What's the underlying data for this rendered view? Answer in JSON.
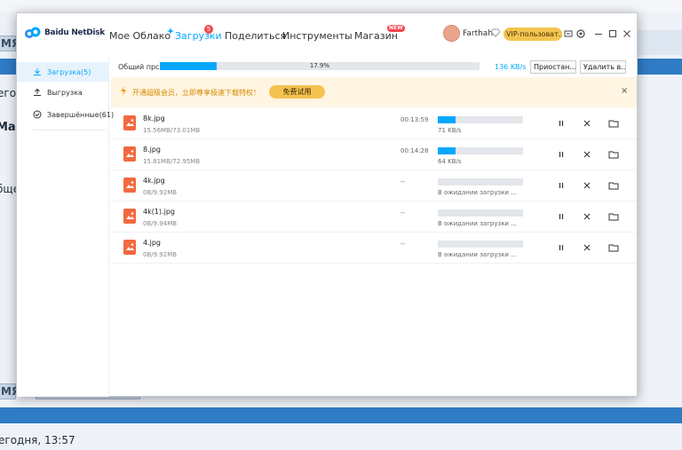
{
  "background": {
    "tab_top_label": "МЯ",
    "line1": "его",
    "line2": "Ма",
    "line3": "бще",
    "tab_bottom_label": "МЯ",
    "footer_text": "егодня, 13:57"
  },
  "app": {
    "logo_text": "Baidu NetDisk",
    "nav": [
      {
        "label": "Мое Облако"
      },
      {
        "label": "Загрузки",
        "badge": "5"
      },
      {
        "label": "Поделиться"
      },
      {
        "label": "Инструменты"
      },
      {
        "label": "Магазин",
        "badge": "NEW"
      }
    ],
    "user_name": "Farthah",
    "vip_label": "VIP-пользоват..."
  },
  "sidebar": {
    "items": [
      {
        "label": "Загрузка(5)"
      },
      {
        "label": "Выгрузка"
      },
      {
        "label": "Завершённые(61)"
      }
    ]
  },
  "main": {
    "total_label": "Общий прс",
    "total_percent": "17.9%",
    "total_progress": 0.179,
    "total_speed": "136 KB/s",
    "pause_all_label": "Приостан...",
    "delete_all_label": "Удалить в...",
    "promo_text": "开通超级会员，立即尊享极速下载特权！",
    "promo_button": "免费试用"
  },
  "downloads": [
    {
      "name": "8k.jpg",
      "size": "15.56MB/73.01MB",
      "time_left": "00:13:59",
      "progress": 0.21,
      "status": "71 KB/s"
    },
    {
      "name": "8.jpg",
      "size": "15.81MB/72.95MB",
      "time_left": "00:14:28",
      "progress": 0.21,
      "status": "64 KB/s"
    },
    {
      "name": "4k.jpg",
      "size": "0B/9.92MB",
      "time_left": "--",
      "progress": 0,
      "status": "В ожидании загрузки ..."
    },
    {
      "name": "4k(1).jpg",
      "size": "0B/9.94MB",
      "time_left": "--",
      "progress": 0,
      "status": "В ожидании загрузки ..."
    },
    {
      "name": "4.jpg",
      "size": "0B/9.92MB",
      "time_left": "--",
      "progress": 0,
      "status": "В ожидании загрузки ..."
    }
  ],
  "colors": {
    "accent": "#06a7ff",
    "file_icon": "#f26a3f",
    "promo_bg": "#fff5e2",
    "vip": "#f3c44f"
  },
  "icons": {
    "logo": "baidu-cloud-icon",
    "download": "download-icon",
    "upload": "upload-icon",
    "completed": "check-circle-icon",
    "pause": "pause-icon",
    "cancel": "close-icon",
    "folder": "folder-icon",
    "settings": "gear-icon",
    "promo": "lightning-icon"
  }
}
